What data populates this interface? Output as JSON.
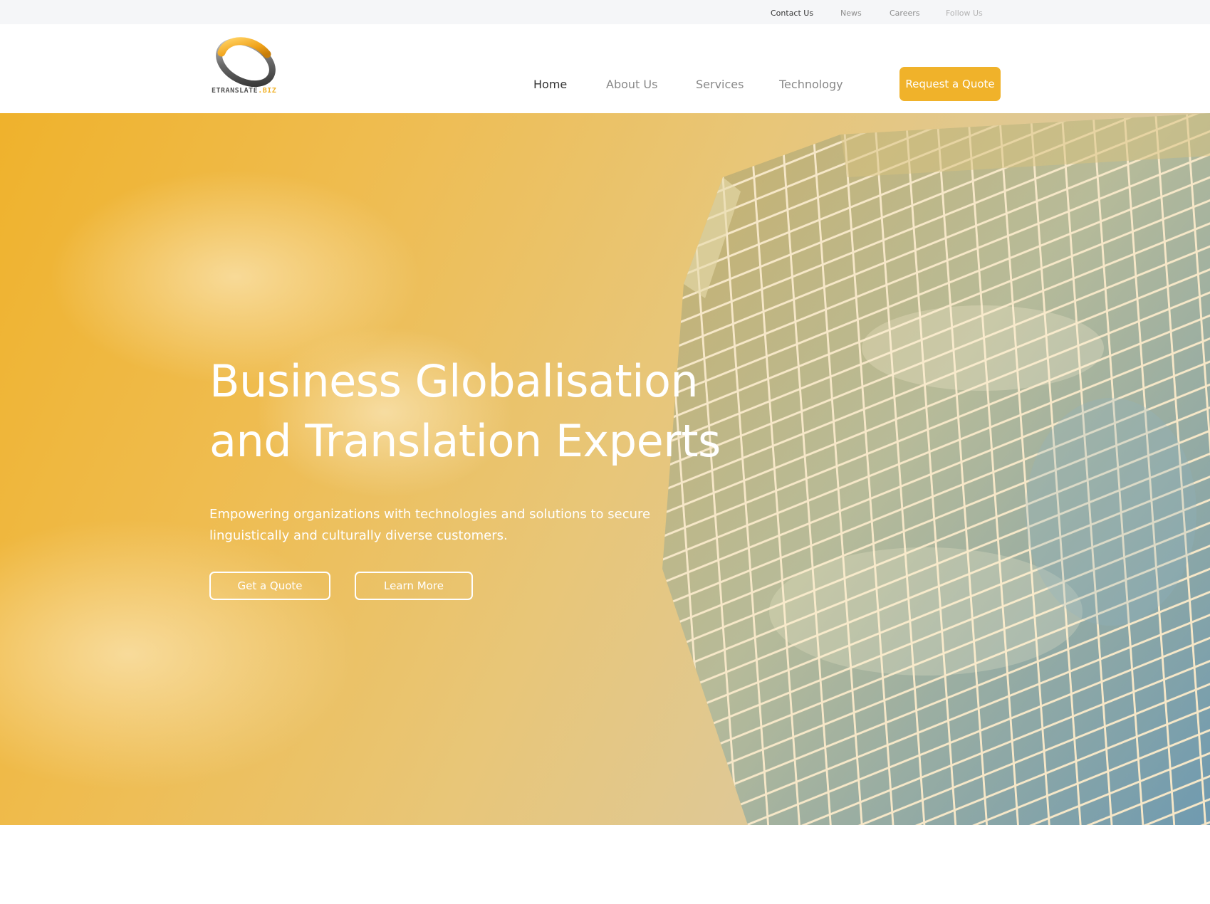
{
  "topbar": {
    "contact": "Contact Us",
    "news": "News",
    "careers": "Careers",
    "follow": "Follow Us"
  },
  "header": {
    "logo": {
      "name": "ETRANSLATE",
      "suffix": ".BIZ"
    },
    "nav": {
      "home": "Home",
      "about": "About Us",
      "services": "Services",
      "technology": "Technology"
    },
    "cta_label": "Request a Quote"
  },
  "hero": {
    "title_line1": "Business Globalisation",
    "title_line2": "and Translation Experts",
    "subtitle": "Empowering organizations with technologies and solutions to secure linguistically and culturally diverse customers.",
    "quote_label": "Get a Quote",
    "learn_label": "Learn More",
    "image": "glass skyscraper against cloudy sky with warm yellow overlay"
  },
  "colors": {
    "accent": "#f0b22a",
    "topbar_bg": "#f5f6f8",
    "nav_text": "#888888",
    "nav_active": "#333333",
    "hero_text": "#ffffff"
  }
}
